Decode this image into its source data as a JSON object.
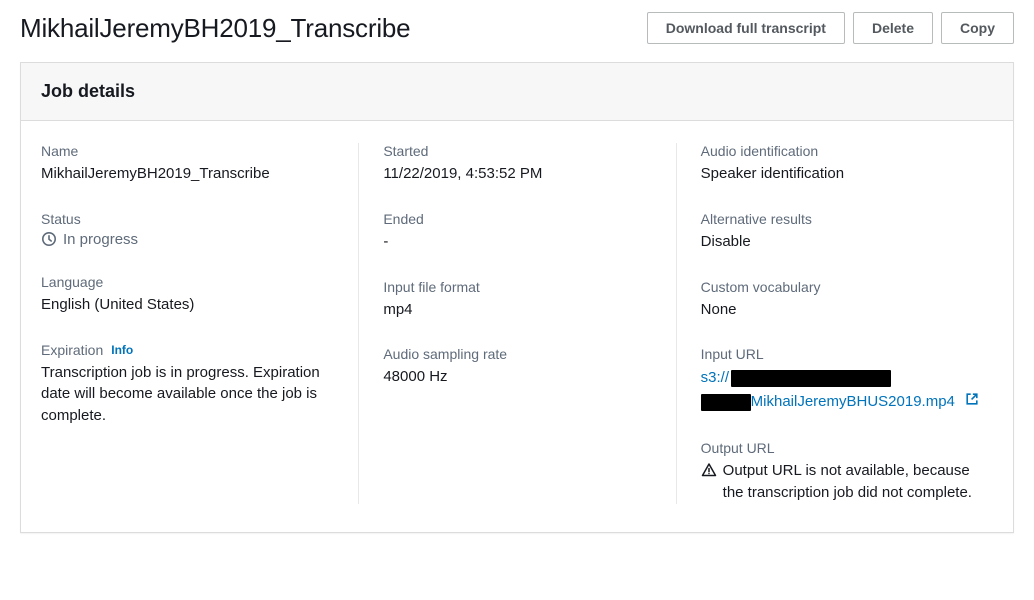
{
  "header": {
    "title": "MikhailJeremyBH2019_Transcribe",
    "download_label": "Download full transcript",
    "delete_label": "Delete",
    "copy_label": "Copy"
  },
  "panel": {
    "title": "Job details"
  },
  "col1": {
    "name_label": "Name",
    "name_value": "MikhailJeremyBH2019_Transcribe",
    "status_label": "Status",
    "status_value": "In progress",
    "language_label": "Language",
    "language_value": "English (United States)",
    "expiration_label": "Expiration",
    "expiration_info": "Info",
    "expiration_value": "Transcription job is in progress. Expiration date will become available once the job is complete."
  },
  "col2": {
    "started_label": "Started",
    "started_value": "11/22/2019, 4:53:52 PM",
    "ended_label": "Ended",
    "ended_value": "-",
    "format_label": "Input file format",
    "format_value": "mp4",
    "sampling_label": "Audio sampling rate",
    "sampling_value": "48000 Hz"
  },
  "col3": {
    "audio_id_label": "Audio identification",
    "audio_id_value": "Speaker identification",
    "alt_label": "Alternative results",
    "alt_value": "Disable",
    "vocab_label": "Custom vocabulary",
    "vocab_value": "None",
    "input_url_label": "Input URL",
    "input_url_prefix": "s3://",
    "input_url_file": "MikhailJeremyBHUS2019.mp4",
    "output_url_label": "Output URL",
    "output_url_value": "Output URL is not available, because the transcription job did not complete."
  }
}
